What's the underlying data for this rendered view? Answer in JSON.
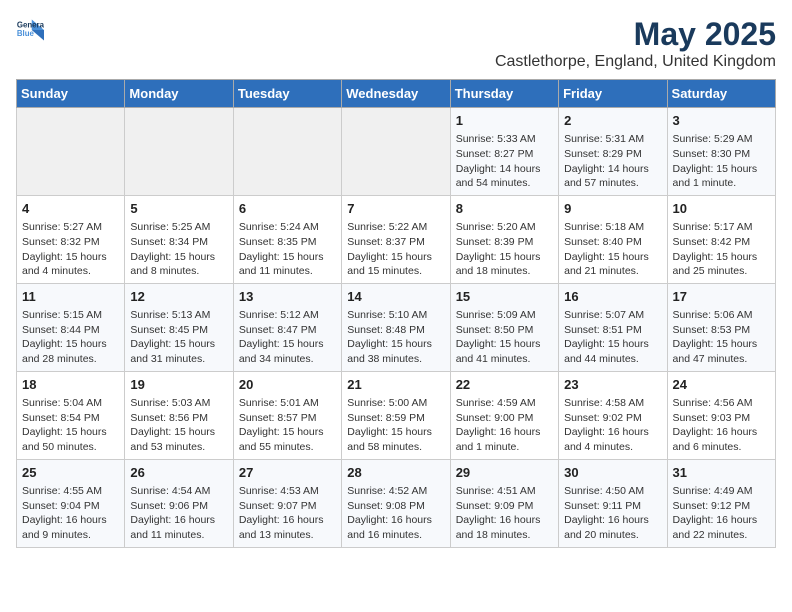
{
  "logo": {
    "line1": "General",
    "line2": "Blue"
  },
  "title": "May 2025",
  "subtitle": "Castlethorpe, England, United Kingdom",
  "headers": [
    "Sunday",
    "Monday",
    "Tuesday",
    "Wednesday",
    "Thursday",
    "Friday",
    "Saturday"
  ],
  "weeks": [
    [
      {
        "day": "",
        "content": ""
      },
      {
        "day": "",
        "content": ""
      },
      {
        "day": "",
        "content": ""
      },
      {
        "day": "",
        "content": ""
      },
      {
        "day": "1",
        "content": "Sunrise: 5:33 AM\nSunset: 8:27 PM\nDaylight: 14 hours\nand 54 minutes."
      },
      {
        "day": "2",
        "content": "Sunrise: 5:31 AM\nSunset: 8:29 PM\nDaylight: 14 hours\nand 57 minutes."
      },
      {
        "day": "3",
        "content": "Sunrise: 5:29 AM\nSunset: 8:30 PM\nDaylight: 15 hours\nand 1 minute."
      }
    ],
    [
      {
        "day": "4",
        "content": "Sunrise: 5:27 AM\nSunset: 8:32 PM\nDaylight: 15 hours\nand 4 minutes."
      },
      {
        "day": "5",
        "content": "Sunrise: 5:25 AM\nSunset: 8:34 PM\nDaylight: 15 hours\nand 8 minutes."
      },
      {
        "day": "6",
        "content": "Sunrise: 5:24 AM\nSunset: 8:35 PM\nDaylight: 15 hours\nand 11 minutes."
      },
      {
        "day": "7",
        "content": "Sunrise: 5:22 AM\nSunset: 8:37 PM\nDaylight: 15 hours\nand 15 minutes."
      },
      {
        "day": "8",
        "content": "Sunrise: 5:20 AM\nSunset: 8:39 PM\nDaylight: 15 hours\nand 18 minutes."
      },
      {
        "day": "9",
        "content": "Sunrise: 5:18 AM\nSunset: 8:40 PM\nDaylight: 15 hours\nand 21 minutes."
      },
      {
        "day": "10",
        "content": "Sunrise: 5:17 AM\nSunset: 8:42 PM\nDaylight: 15 hours\nand 25 minutes."
      }
    ],
    [
      {
        "day": "11",
        "content": "Sunrise: 5:15 AM\nSunset: 8:44 PM\nDaylight: 15 hours\nand 28 minutes."
      },
      {
        "day": "12",
        "content": "Sunrise: 5:13 AM\nSunset: 8:45 PM\nDaylight: 15 hours\nand 31 minutes."
      },
      {
        "day": "13",
        "content": "Sunrise: 5:12 AM\nSunset: 8:47 PM\nDaylight: 15 hours\nand 34 minutes."
      },
      {
        "day": "14",
        "content": "Sunrise: 5:10 AM\nSunset: 8:48 PM\nDaylight: 15 hours\nand 38 minutes."
      },
      {
        "day": "15",
        "content": "Sunrise: 5:09 AM\nSunset: 8:50 PM\nDaylight: 15 hours\nand 41 minutes."
      },
      {
        "day": "16",
        "content": "Sunrise: 5:07 AM\nSunset: 8:51 PM\nDaylight: 15 hours\nand 44 minutes."
      },
      {
        "day": "17",
        "content": "Sunrise: 5:06 AM\nSunset: 8:53 PM\nDaylight: 15 hours\nand 47 minutes."
      }
    ],
    [
      {
        "day": "18",
        "content": "Sunrise: 5:04 AM\nSunset: 8:54 PM\nDaylight: 15 hours\nand 50 minutes."
      },
      {
        "day": "19",
        "content": "Sunrise: 5:03 AM\nSunset: 8:56 PM\nDaylight: 15 hours\nand 53 minutes."
      },
      {
        "day": "20",
        "content": "Sunrise: 5:01 AM\nSunset: 8:57 PM\nDaylight: 15 hours\nand 55 minutes."
      },
      {
        "day": "21",
        "content": "Sunrise: 5:00 AM\nSunset: 8:59 PM\nDaylight: 15 hours\nand 58 minutes."
      },
      {
        "day": "22",
        "content": "Sunrise: 4:59 AM\nSunset: 9:00 PM\nDaylight: 16 hours\nand 1 minute."
      },
      {
        "day": "23",
        "content": "Sunrise: 4:58 AM\nSunset: 9:02 PM\nDaylight: 16 hours\nand 4 minutes."
      },
      {
        "day": "24",
        "content": "Sunrise: 4:56 AM\nSunset: 9:03 PM\nDaylight: 16 hours\nand 6 minutes."
      }
    ],
    [
      {
        "day": "25",
        "content": "Sunrise: 4:55 AM\nSunset: 9:04 PM\nDaylight: 16 hours\nand 9 minutes."
      },
      {
        "day": "26",
        "content": "Sunrise: 4:54 AM\nSunset: 9:06 PM\nDaylight: 16 hours\nand 11 minutes."
      },
      {
        "day": "27",
        "content": "Sunrise: 4:53 AM\nSunset: 9:07 PM\nDaylight: 16 hours\nand 13 minutes."
      },
      {
        "day": "28",
        "content": "Sunrise: 4:52 AM\nSunset: 9:08 PM\nDaylight: 16 hours\nand 16 minutes."
      },
      {
        "day": "29",
        "content": "Sunrise: 4:51 AM\nSunset: 9:09 PM\nDaylight: 16 hours\nand 18 minutes."
      },
      {
        "day": "30",
        "content": "Sunrise: 4:50 AM\nSunset: 9:11 PM\nDaylight: 16 hours\nand 20 minutes."
      },
      {
        "day": "31",
        "content": "Sunrise: 4:49 AM\nSunset: 9:12 PM\nDaylight: 16 hours\nand 22 minutes."
      }
    ]
  ]
}
